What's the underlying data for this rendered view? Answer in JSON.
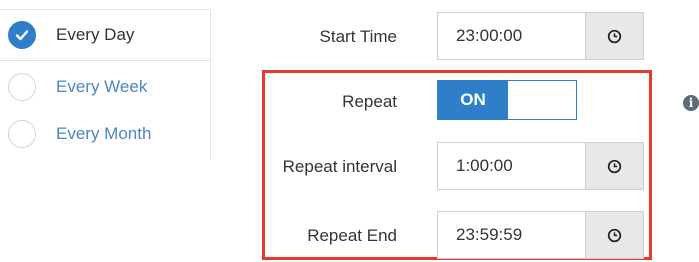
{
  "frequency": {
    "options": [
      {
        "label": "Every Day",
        "selected": true
      },
      {
        "label": "Every Week",
        "selected": false
      },
      {
        "label": "Every Month",
        "selected": false
      }
    ]
  },
  "form": {
    "start_time": {
      "label": "Start Time",
      "value": "23:00:00",
      "icon": "clock-icon"
    },
    "repeat": {
      "label": "Repeat",
      "toggle_on_label": "ON",
      "state": true,
      "info_icon": "info-icon"
    },
    "repeat_interval": {
      "label": "Repeat interval",
      "value": "1:00:00",
      "icon": "clock-icon"
    },
    "repeat_end": {
      "label": "Repeat End",
      "value": "23:59:59",
      "icon": "clock-icon"
    }
  },
  "colors": {
    "accent": "#2f7fc8",
    "link_text": "#4a86c4",
    "highlight_border": "#e8392f",
    "clock_button_bg": "#e8e8e8"
  }
}
